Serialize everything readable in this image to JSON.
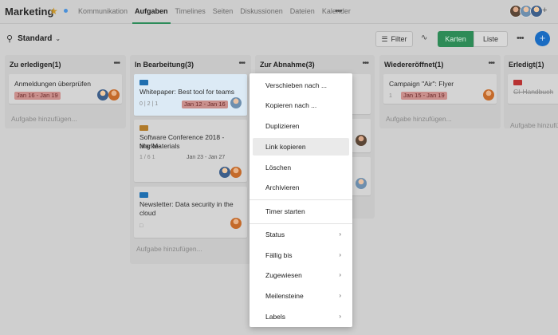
{
  "project": {
    "title": "Marketing"
  },
  "nav": {
    "tabs": [
      "Kommunikation",
      "Aufgaben",
      "Timelines",
      "Seiten",
      "Diskussionen",
      "Dateien",
      "Kalender"
    ],
    "active": "Aufgaben",
    "add": "+"
  },
  "toolbar": {
    "view": "Standard",
    "filter": "Filter",
    "karten": "Karten",
    "liste": "Liste",
    "add": "+"
  },
  "columns": [
    {
      "title": "Zu erledigen(1)",
      "cards": [
        {
          "title": "Anmeldungen überprüfen",
          "date": "Jan 16 - Jan 19"
        }
      ],
      "add": "Aufgabe hinzufügen..."
    },
    {
      "title": "In Bearbeitung(3)",
      "cards": [
        {
          "title": "Whitepaper: Best tool for teams",
          "meta": "0 | 2 | 1",
          "date": "Jan 12 - Jan 16",
          "tag_color": "#1f6fb0"
        },
        {
          "title": "Software Conference 2018 - Marketing Materials",
          "title_line1": "Software Conference 2018 - Marke-",
          "title_line2": "ting Materials",
          "meta": "1 / 6   1",
          "date": "Jan 23 - Jan 27",
          "tag_color": "#b07a2a"
        },
        {
          "title": "Newsletter: Data security in the cloud",
          "title_line1": "Newsletter: Data security in the",
          "title_line2": "cloud",
          "tag_color": "#1f6fb0"
        }
      ],
      "add": "Aufgabe hinzufügen..."
    },
    {
      "title": "Zur Abnahme(3)"
    },
    {
      "title": "Wiedereröffnet(1)",
      "cards": [
        {
          "title": "Campaign \"Air\": Flyer",
          "date": "Jan 15 - Jan 19",
          "meta": "1"
        }
      ],
      "add": "Aufgabe hinzufügen..."
    },
    {
      "title": "Erledigt(1)",
      "cards": [
        {
          "title": "CI-Handbuch",
          "tag_color": "#b83232"
        }
      ],
      "add": "Aufgabe hinzufüge"
    }
  ],
  "context_menu": {
    "items": [
      {
        "label": "Verschieben nach ..."
      },
      {
        "label": "Kopieren nach ..."
      },
      {
        "label": "Duplizieren"
      },
      {
        "label": "Link kopieren"
      },
      {
        "label": "Löschen"
      },
      {
        "label": "Archivieren"
      },
      {
        "label": "Timer starten"
      },
      {
        "label": "Status"
      },
      {
        "label": "Fällig bis"
      },
      {
        "label": "Zugewiesen"
      },
      {
        "label": "Meilensteine"
      },
      {
        "label": "Labels"
      }
    ],
    "hovered": "Link kopieren"
  }
}
